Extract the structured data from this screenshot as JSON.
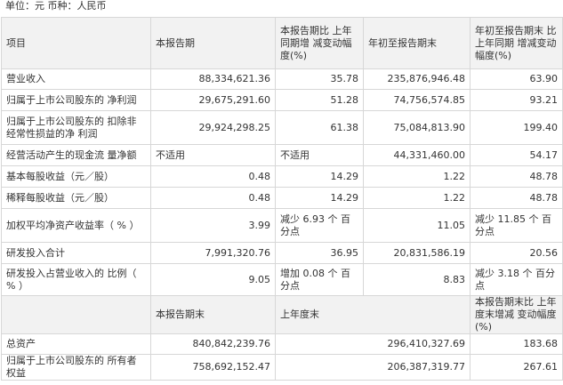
{
  "unit_text": "单位：元 币种：人民币",
  "header1": {
    "item": "项目",
    "current": "本报告期",
    "current_change": "本报告期比 上年同期增 减变动幅度(%)",
    "ytd": "年初至报告期末",
    "ytd_change": "年初至报告期末 比上年同期 增减变动幅度(%)"
  },
  "rows": [
    {
      "item": "营业收入",
      "current": "88,334,621.36",
      "current_change": "35.78",
      "ytd": "235,876,946.48",
      "ytd_change": "63.90"
    },
    {
      "item": "归属于上市公司股东的 净利润",
      "current": "29,675,291.60",
      "current_change": "51.28",
      "ytd": "74,756,574.85",
      "ytd_change": "93.21"
    },
    {
      "item": "归属于上市公司股东的 扣除非经常性损益的净 利润",
      "current": "29,924,298.25",
      "current_change": "61.38",
      "ytd": "75,084,813.90",
      "ytd_change": "199.40"
    },
    {
      "item": "经营活动产生的现金流 量净额",
      "current": "不适用",
      "current_change": "不适用",
      "ytd": "44,331,460.00",
      "ytd_change": "54.17"
    },
    {
      "item": "基本每股收益（元／股）",
      "current": "0.48",
      "current_change": "14.29",
      "ytd": "1.22",
      "ytd_change": "48.78"
    },
    {
      "item": "稀释每股收益（元／股）",
      "current": "0.48",
      "current_change": "14.29",
      "ytd": "1.22",
      "ytd_change": "48.78"
    },
    {
      "item": "加权平均净资产收益率（ % ）",
      "current": "3.99",
      "current_change": "减少 6.93 个 百分点",
      "ytd": "11.05",
      "ytd_change": "减少 11.85 个 百分点"
    },
    {
      "item": "研发投入合计",
      "current": "7,991,320.76",
      "current_change": "36.95",
      "ytd": "20,831,586.19",
      "ytd_change": "20.56"
    },
    {
      "item": "研发投入占营业收入的 比例（ % ）",
      "current": "9.05",
      "current_change": "增加 0.08 个 百分点",
      "ytd": "8.83",
      "ytd_change": "减少 3.18 个 百分点"
    }
  ],
  "header2": {
    "current_end": "本报告期末",
    "last_year_end": "上年度末",
    "change": "本报告期末比 上年度末增减 变动幅度(%)"
  },
  "rows2": [
    {
      "item": "总资产",
      "current_end": "840,842,239.76",
      "last_year_end": "296,410,327.69",
      "change": "183.68"
    },
    {
      "item": "归属于上市公司股东的 所有者权益",
      "current_end": "758,692,152.47",
      "last_year_end": "206,387,319.77",
      "change": "267.61"
    }
  ]
}
